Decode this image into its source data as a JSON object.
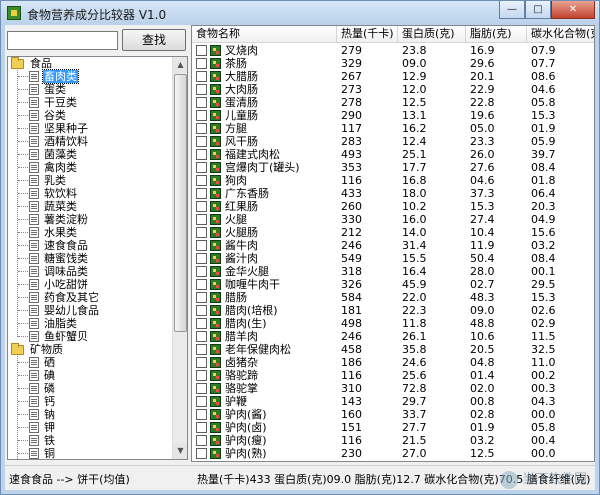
{
  "window": {
    "title": "食物营养成分比较器 V1.0",
    "minimize_glyph": "—",
    "maximize_glyph": "□",
    "close_glyph": "✕"
  },
  "search": {
    "value": "",
    "button_label": "查找"
  },
  "tree": {
    "root_food": "食品",
    "food_items": [
      "畜肉类",
      "蛋类",
      "干豆类",
      "谷类",
      "坚果种子",
      "酒精饮料",
      "菌藻类",
      "禽肉类",
      "乳类",
      "软饮料",
      "蔬菜类",
      "薯类淀粉",
      "水果类",
      "速食食品",
      "糖蜜饯类",
      "调味品类",
      "小吃甜饼",
      "药食及其它",
      "婴幼儿食品",
      "油脂类",
      "鱼虾蟹贝"
    ],
    "selected_index": 0,
    "root_mineral": "矿物质",
    "mineral_items": [
      "硒",
      "碘",
      "磷",
      "钙",
      "钠",
      "钾",
      "铁",
      "铜",
      "锌"
    ]
  },
  "table": {
    "headers": [
      "食物名称",
      "热量(千卡)",
      "蛋白质(克)",
      "脂肪(克)",
      "碳水化合物(克)"
    ],
    "rows": [
      [
        "叉烧肉",
        "279",
        "23.8",
        "16.9",
        "07.9"
      ],
      [
        "茶肠",
        "329",
        "09.0",
        "29.6",
        "07.7"
      ],
      [
        "大腊肠",
        "267",
        "12.9",
        "20.1",
        "08.6"
      ],
      [
        "大肉肠",
        "273",
        "12.0",
        "22.9",
        "04.6"
      ],
      [
        "蛋清肠",
        "278",
        "12.5",
        "22.8",
        "05.8"
      ],
      [
        "儿童肠",
        "290",
        "13.1",
        "19.6",
        "15.3"
      ],
      [
        "方腿",
        "117",
        "16.2",
        "05.0",
        "01.9"
      ],
      [
        "风干肠",
        "283",
        "12.4",
        "23.3",
        "05.9"
      ],
      [
        "福建式肉松",
        "493",
        "25.1",
        "26.0",
        "39.7"
      ],
      [
        "宫爆肉丁(罐头)",
        "353",
        "17.7",
        "27.6",
        "08.4"
      ],
      [
        "狗肉",
        "116",
        "16.8",
        "04.6",
        "01.8"
      ],
      [
        "广东香肠",
        "433",
        "18.0",
        "37.3",
        "06.4"
      ],
      [
        "红果肠",
        "260",
        "10.2",
        "15.3",
        "20.3"
      ],
      [
        "火腿",
        "330",
        "16.0",
        "27.4",
        "04.9"
      ],
      [
        "火腿肠",
        "212",
        "14.0",
        "10.4",
        "15.6"
      ],
      [
        "酱牛肉",
        "246",
        "31.4",
        "11.9",
        "03.2"
      ],
      [
        "酱汁肉",
        "549",
        "15.5",
        "50.4",
        "08.4"
      ],
      [
        "金华火腿",
        "318",
        "16.4",
        "28.0",
        "00.1"
      ],
      [
        "咖喱牛肉干",
        "326",
        "45.9",
        "02.7",
        "29.5"
      ],
      [
        "腊肠",
        "584",
        "22.0",
        "48.3",
        "15.3"
      ],
      [
        "腊肉(培根)",
        "181",
        "22.3",
        "09.0",
        "02.6"
      ],
      [
        "腊肉(生)",
        "498",
        "11.8",
        "48.8",
        "02.9"
      ],
      [
        "腊羊肉",
        "246",
        "26.1",
        "10.6",
        "11.5"
      ],
      [
        "老年保健肉松",
        "458",
        "35.8",
        "20.5",
        "32.5"
      ],
      [
        "卤猪杂",
        "186",
        "24.6",
        "04.8",
        "11.0"
      ],
      [
        "骆驼蹄",
        "116",
        "25.6",
        "01.4",
        "00.2"
      ],
      [
        "骆驼掌",
        "310",
        "72.8",
        "02.0",
        "00.3"
      ],
      [
        "驴鞭",
        "143",
        "29.7",
        "00.8",
        "04.3"
      ],
      [
        "驴肉(酱)",
        "160",
        "33.7",
        "02.8",
        "00.0"
      ],
      [
        "驴肉(卤)",
        "151",
        "27.7",
        "01.9",
        "05.8"
      ],
      [
        "驴肉(瘦)",
        "116",
        "21.5",
        "03.2",
        "00.4"
      ],
      [
        "驴肉(熟)",
        "230",
        "27.0",
        "12.5",
        "00.0"
      ]
    ]
  },
  "status": {
    "left": "速食食品 --> 饼干(均值)",
    "right": "热量(千卡)433 蛋白质(克)09.0 脂肪(克)12.7 碳水化合物(克)70.5 膳食纤维(克)08.1 维生"
  },
  "watermark": {
    "text": "当下软件园"
  }
}
